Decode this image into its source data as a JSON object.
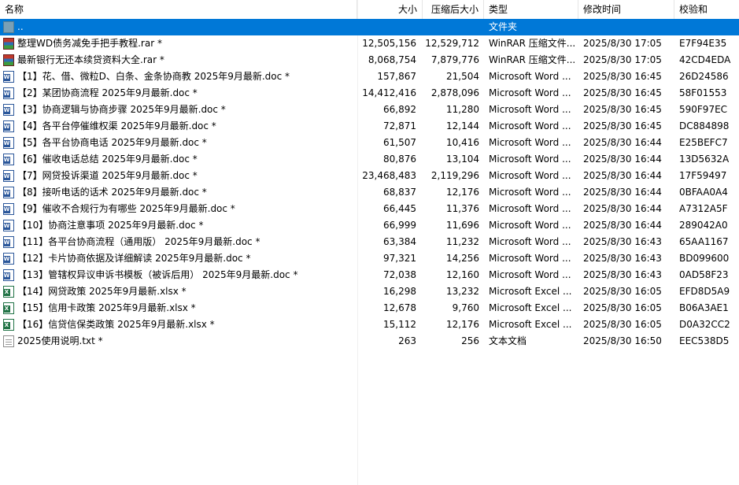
{
  "columns": {
    "name": "名称",
    "size": "大小",
    "packed": "压缩后大小",
    "type": "类型",
    "modified": "修改时间",
    "crc": "校验和"
  },
  "sort_indicator": "^",
  "files": [
    {
      "name": "..",
      "size": "",
      "packed": "",
      "type": "文件夹",
      "modified": "",
      "crc": "",
      "icon": "folder-up-icon",
      "selected": true
    },
    {
      "name": "整理WD债务减免手把手教程.rar *",
      "size": "12,505,156",
      "packed": "12,529,712",
      "type": "WinRAR 压缩文件...",
      "modified": "2025/8/30 17:05",
      "crc": "E7F94E35",
      "icon": "rar-archive-icon"
    },
    {
      "name": "最新银行无还本续贷资料大全.rar *",
      "size": "8,068,754",
      "packed": "7,879,776",
      "type": "WinRAR 压缩文件...",
      "modified": "2025/8/30 17:05",
      "crc": "42CD4EDA",
      "icon": "rar-archive-icon"
    },
    {
      "name": "【1】花、借、微粒D、白条、金条协商教 2025年9月最新.doc *",
      "size": "157,867",
      "packed": "21,504",
      "type": "Microsoft Word ...",
      "modified": "2025/8/30 16:45",
      "crc": "26D24586",
      "icon": "word-doc-icon"
    },
    {
      "name": "【2】某团协商流程 2025年9月最新.doc *",
      "size": "14,412,416",
      "packed": "2,878,096",
      "type": "Microsoft Word ...",
      "modified": "2025/8/30 16:45",
      "crc": "58F01553",
      "icon": "word-doc-icon"
    },
    {
      "name": "【3】协商逻辑与协商步骤 2025年9月最新.doc *",
      "size": "66,892",
      "packed": "11,280",
      "type": "Microsoft Word ...",
      "modified": "2025/8/30 16:45",
      "crc": "590F97EC",
      "icon": "word-doc-icon"
    },
    {
      "name": "【4】各平台停催维权渠 2025年9月最新.doc *",
      "size": "72,871",
      "packed": "12,144",
      "type": "Microsoft Word ...",
      "modified": "2025/8/30 16:45",
      "crc": "DC884898",
      "icon": "word-doc-icon"
    },
    {
      "name": "【5】各平台协商电话 2025年9月最新.doc *",
      "size": "61,507",
      "packed": "10,416",
      "type": "Microsoft Word ...",
      "modified": "2025/8/30 16:44",
      "crc": "E25BEFC7",
      "icon": "word-doc-icon"
    },
    {
      "name": "【6】催收电话总结 2025年9月最新.doc *",
      "size": "80,876",
      "packed": "13,104",
      "type": "Microsoft Word ...",
      "modified": "2025/8/30 16:44",
      "crc": "13D5632A",
      "icon": "word-doc-icon"
    },
    {
      "name": "【7】网贷投诉渠道 2025年9月最新.doc *",
      "size": "23,468,483",
      "packed": "2,119,296",
      "type": "Microsoft Word ...",
      "modified": "2025/8/30 16:44",
      "crc": "17F59497",
      "icon": "word-doc-icon"
    },
    {
      "name": "【8】接听电话的话术 2025年9月最新.doc *",
      "size": "68,837",
      "packed": "12,176",
      "type": "Microsoft Word ...",
      "modified": "2025/8/30 16:44",
      "crc": "0BFAA0A4",
      "icon": "word-doc-icon"
    },
    {
      "name": "【9】催收不合规行为有哪些 2025年9月最新.doc *",
      "size": "66,445",
      "packed": "11,376",
      "type": "Microsoft Word ...",
      "modified": "2025/8/30 16:44",
      "crc": "A7312A5F",
      "icon": "word-doc-icon"
    },
    {
      "name": "【10】协商注意事项 2025年9月最新.doc *",
      "size": "66,999",
      "packed": "11,696",
      "type": "Microsoft Word ...",
      "modified": "2025/8/30 16:44",
      "crc": "289042A0",
      "icon": "word-doc-icon"
    },
    {
      "name": "【11】各平台协商流程（通用版） 2025年9月最新.doc *",
      "size": "63,384",
      "packed": "11,232",
      "type": "Microsoft Word ...",
      "modified": "2025/8/30 16:43",
      "crc": "65AA1167",
      "icon": "word-doc-icon"
    },
    {
      "name": "【12】卡片协商依据及详细解读 2025年9月最新.doc *",
      "size": "97,321",
      "packed": "14,256",
      "type": "Microsoft Word ...",
      "modified": "2025/8/30 16:43",
      "crc": "BD099600",
      "icon": "word-doc-icon"
    },
    {
      "name": "【13】管辖权异议申诉书模板（被诉后用） 2025年9月最新.doc *",
      "size": "72,038",
      "packed": "12,160",
      "type": "Microsoft Word ...",
      "modified": "2025/8/30 16:43",
      "crc": "0AD58F23",
      "icon": "word-doc-icon"
    },
    {
      "name": "【14】网贷政策 2025年9月最新.xlsx *",
      "size": "16,298",
      "packed": "13,232",
      "type": "Microsoft Excel ...",
      "modified": "2025/8/30 16:05",
      "crc": "EFD8D5A9",
      "icon": "excel-sheet-icon"
    },
    {
      "name": "【15】信用卡政策 2025年9月最新.xlsx *",
      "size": "12,678",
      "packed": "9,760",
      "type": "Microsoft Excel ...",
      "modified": "2025/8/30 16:05",
      "crc": "B06A3AE1",
      "icon": "excel-sheet-icon"
    },
    {
      "name": "【16】信贷信保类政策 2025年9月最新.xlsx *",
      "size": "15,112",
      "packed": "12,176",
      "type": "Microsoft Excel ...",
      "modified": "2025/8/30 16:05",
      "crc": "D0A32CC2",
      "icon": "excel-sheet-icon"
    },
    {
      "name": "2025使用说明.txt *",
      "size": "263",
      "packed": "256",
      "type": "文本文档",
      "modified": "2025/8/30 16:50",
      "crc": "EEC538D5",
      "icon": "text-file-icon"
    }
  ],
  "colors": {
    "selection": "#0078d7",
    "header_border": "#e5e5e5"
  }
}
